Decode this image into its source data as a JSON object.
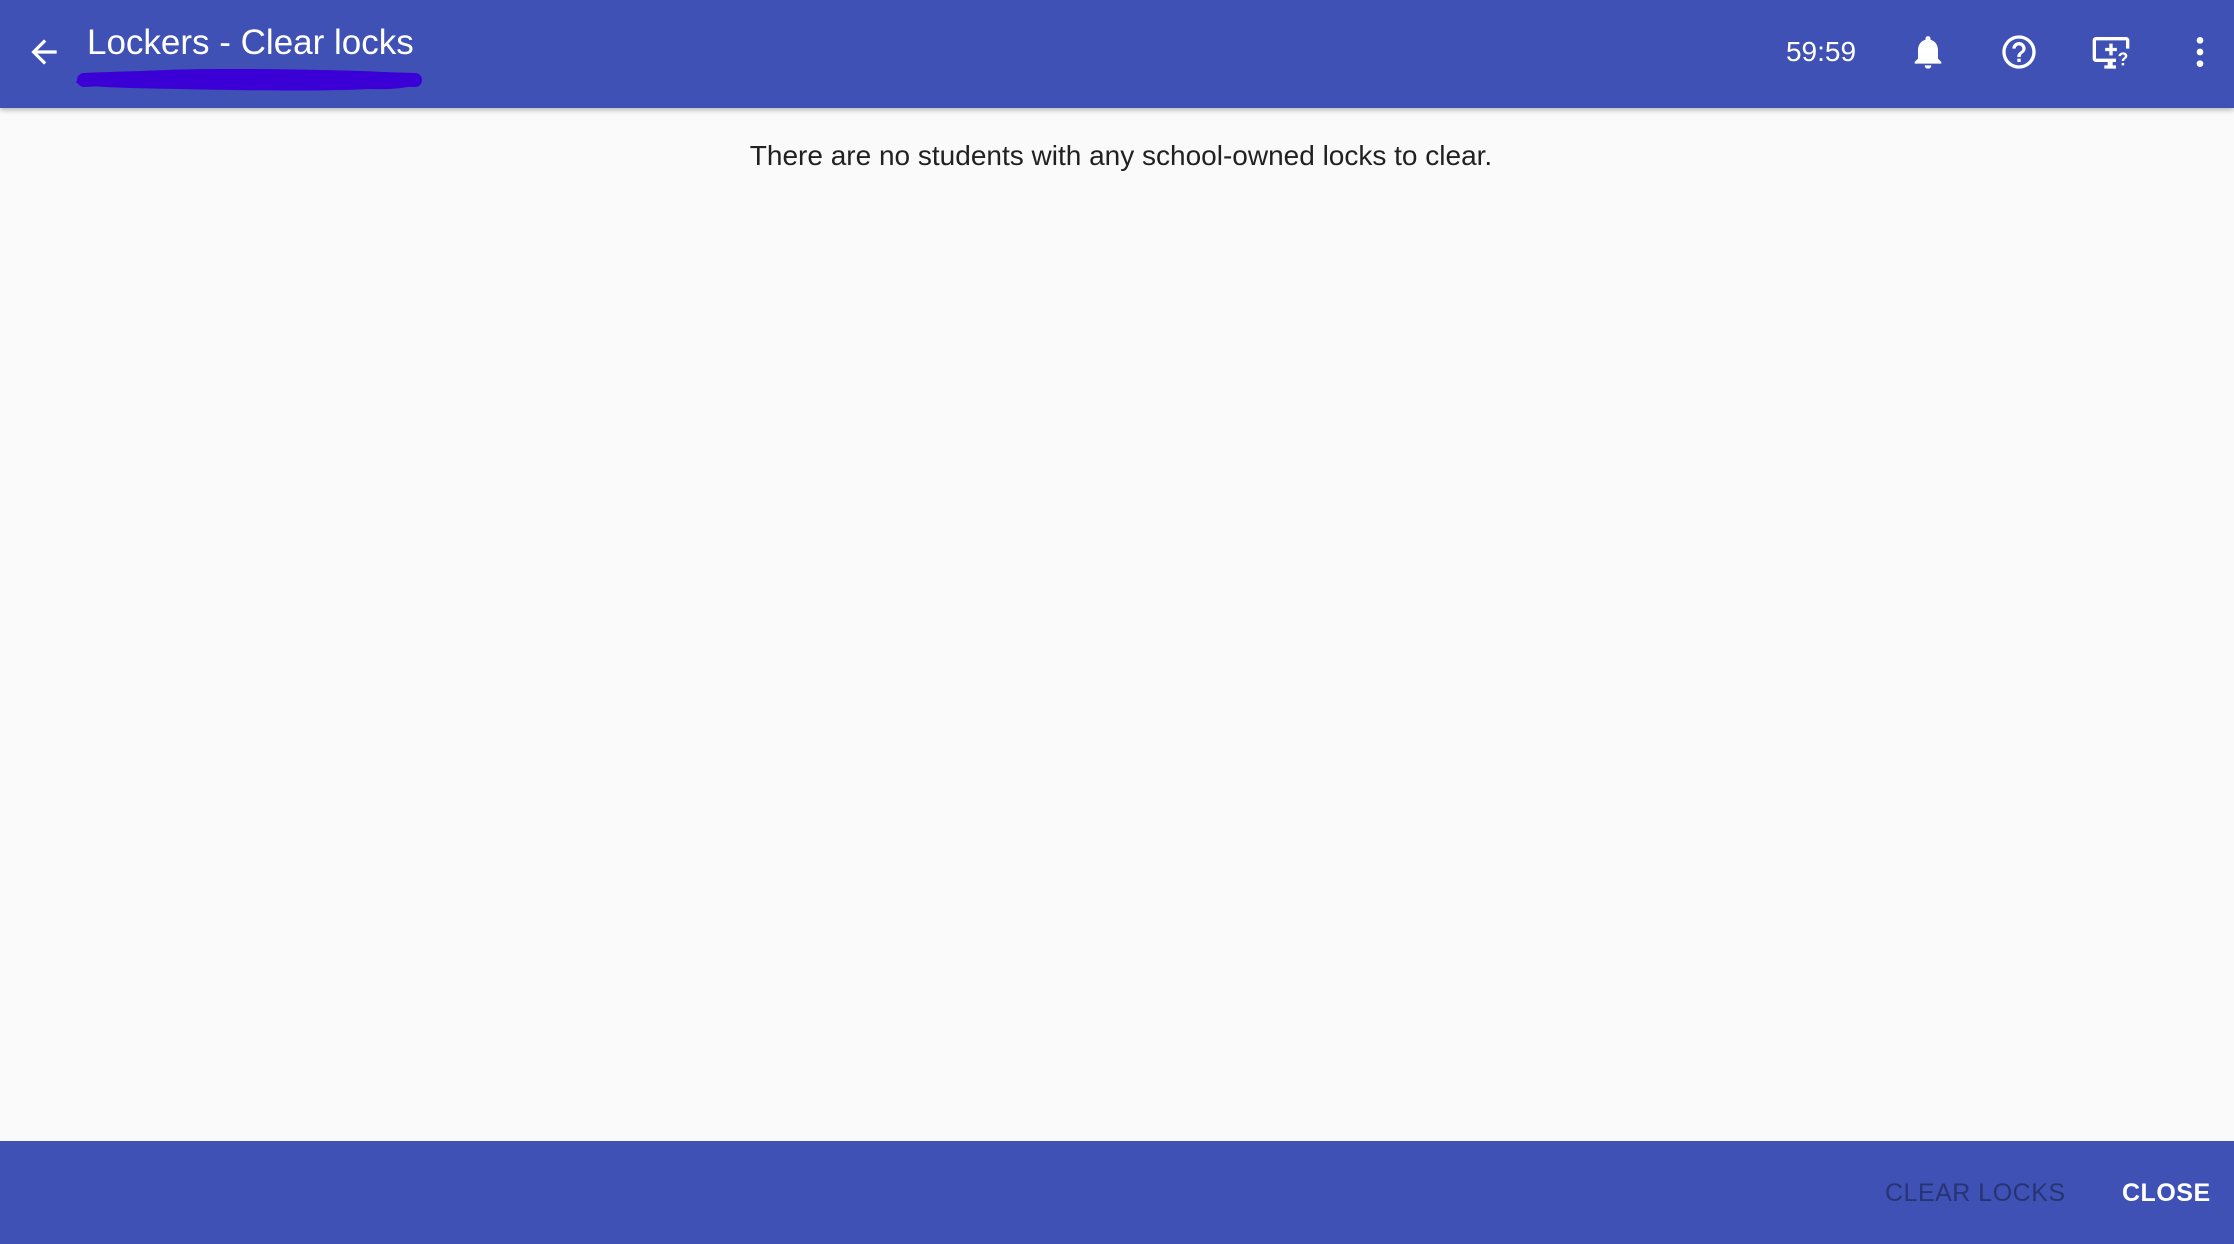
{
  "header": {
    "title": "Lockers - Clear locks",
    "timer": "59:59",
    "icons": {
      "back": "arrow-back-icon",
      "notifications": "bell-icon",
      "help": "help-circle-icon",
      "remote": "remote-support-icon",
      "more": "more-vertical-icon"
    }
  },
  "main": {
    "message": "There are no students with any school-owned locks to clear."
  },
  "footer": {
    "clear_locks_label": "CLEAR LOCKS",
    "clear_locks_enabled": false,
    "close_label": "CLOSE"
  },
  "colors": {
    "primary": "#3f51b5",
    "background": "#fafafa",
    "scribble": "#3a00d6",
    "text": "#212121"
  }
}
